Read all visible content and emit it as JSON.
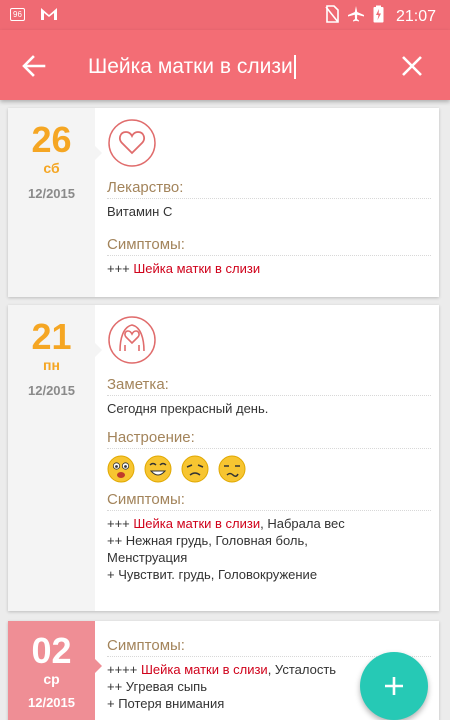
{
  "status_bar": {
    "badge": "96",
    "time": "21:07"
  },
  "toolbar": {
    "search_value": "Шейка матки в слизи"
  },
  "entries": [
    {
      "day": "26",
      "weekday": "сб",
      "month": "12/2015",
      "icon": "heart-icon",
      "medicine_title": "Лекарство:",
      "medicine_value": "Витамин С",
      "symptoms_title": "Симптомы:",
      "symptoms_prefix": "+++ ",
      "symptoms_highlight": "Шейка матки в слизи"
    },
    {
      "day": "21",
      "weekday": "пн",
      "month": "12/2015",
      "icon": "heart-hands-icon",
      "note_title": "Заметка:",
      "note_value": "Сегодня прекрасный день.",
      "mood_title": "Настроение:",
      "moods": [
        "happy-face-icon",
        "grinning-face-icon",
        "tired-face-icon",
        "confused-face-icon"
      ],
      "symptoms_title": "Симптомы:",
      "symptoms_line1_prefix": "+++ ",
      "symptoms_line1_highlight": "Шейка матки в слизи",
      "symptoms_line1_rest": ", Набрала вес",
      "symptoms_line2": "++ Нежная грудь, Головная боль,",
      "symptoms_line3": "Менструация",
      "symptoms_line4": "+ Чувствит. грудь, Головокружение"
    },
    {
      "day": "02",
      "weekday": "ср",
      "month": "12/2015",
      "symptoms_title": "Симптомы:",
      "symptoms_line1_prefix": "++++ ",
      "symptoms_line1_highlight": "Шейка матки в слизи",
      "symptoms_line1_rest": ", Усталость",
      "symptoms_line2": "++ Угревая сыпь",
      "symptoms_line3": "+ Потеря внимания"
    }
  ],
  "colors": {
    "toolbar": "#f36d75",
    "accent_day": "#f5a623",
    "section_title": "#a3845b",
    "highlight": "#d0021b",
    "fab": "#26c9b5"
  }
}
